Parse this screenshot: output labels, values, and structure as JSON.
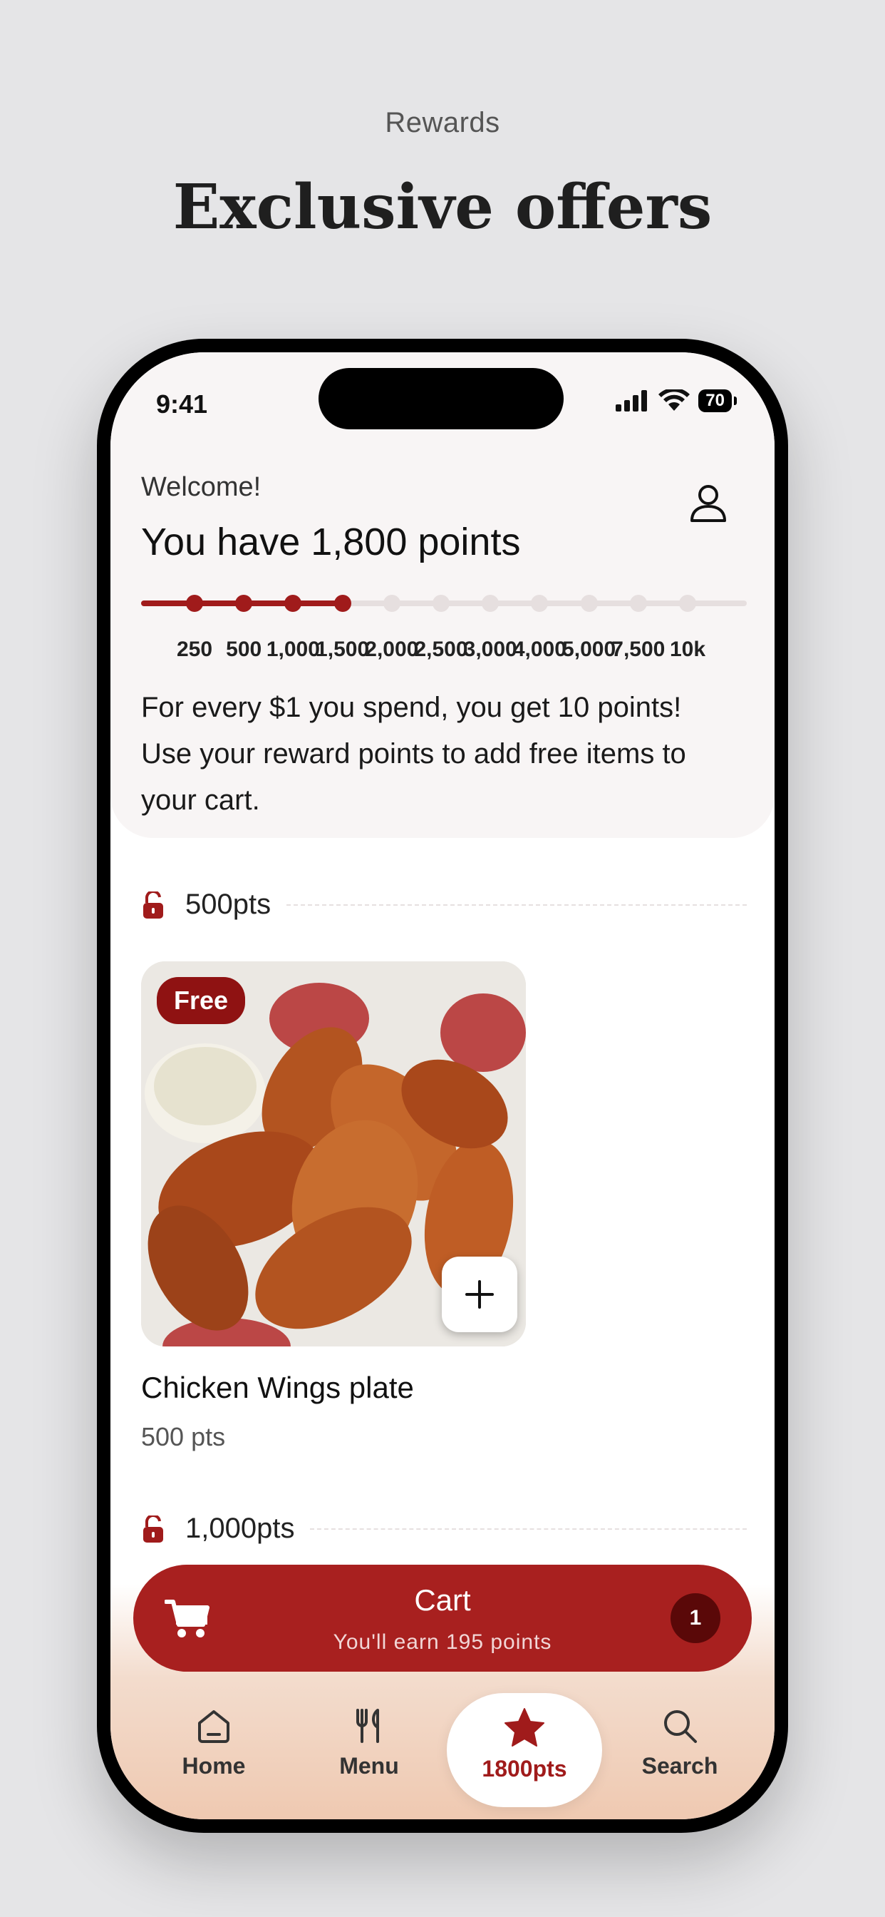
{
  "header": {
    "eyebrow": "Rewards",
    "title": "Exclusive offers"
  },
  "status_bar": {
    "time": "9:41",
    "battery": "70"
  },
  "welcome": {
    "greeting": "Welcome!",
    "points_line": "You have 1,800 points",
    "current_points": 1800
  },
  "progress": {
    "milestones": [
      "250",
      "500",
      "1,000",
      "1,500",
      "2,000",
      "2,500",
      "3,000",
      "4,000",
      "5,000",
      "7,500",
      "10k"
    ],
    "reached_count": 4
  },
  "info_text": "For every $1 you spend, you get 10 points! Use your reward points to add free items to your cart.",
  "tiers": [
    {
      "label": "500pts"
    },
    {
      "label": "1,000pts"
    }
  ],
  "item": {
    "badge": "Free",
    "name": "Chicken Wings plate",
    "points": "500 pts",
    "add_icon": "plus-icon"
  },
  "cart": {
    "title": "Cart",
    "subtitle": "You'll earn 195 points",
    "count": "1"
  },
  "nav": {
    "items": [
      {
        "label": "Home",
        "icon": "home-icon"
      },
      {
        "label": "Menu",
        "icon": "utensils-icon"
      },
      {
        "label": "1800pts",
        "icon": "star-icon"
      },
      {
        "label": "Search",
        "icon": "search-icon"
      }
    ]
  },
  "colors": {
    "brand": "#a8201f",
    "brand_dark": "#8f1212",
    "background": "#e5e5e7"
  }
}
